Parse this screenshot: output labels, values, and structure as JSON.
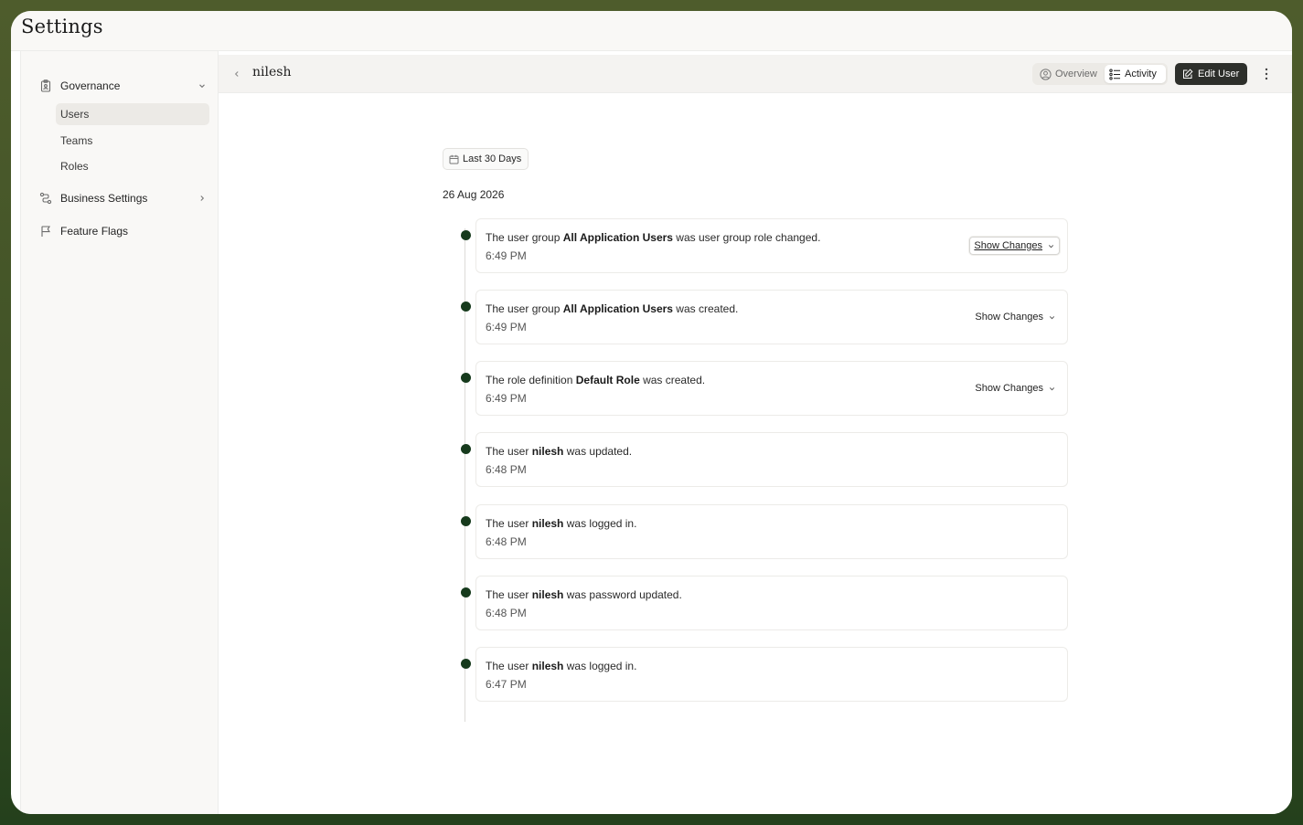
{
  "app": {
    "title": "Settings"
  },
  "sidebar": {
    "governance": {
      "label": "Governance",
      "icon": "clipboard-icon"
    },
    "sub_items": [
      {
        "label": "Users",
        "active": true
      },
      {
        "label": "Teams",
        "active": false
      },
      {
        "label": "Roles",
        "active": false
      }
    ],
    "business_settings": {
      "label": "Business Settings",
      "icon": "route-icon"
    },
    "feature_flags": {
      "label": "Feature Flags",
      "icon": "flag-icon"
    }
  },
  "header": {
    "user_name": "nilesh",
    "tabs": {
      "overview": "Overview",
      "activity": "Activity"
    },
    "edit_label": "Edit User"
  },
  "filter": {
    "range_label": "Last 30 Days"
  },
  "date_group": "26 Aug 2026",
  "activities": [
    {
      "prefix": "The user group ",
      "entity": "All Application Users",
      "suffix": " was user group role changed.",
      "time": "6:49 PM",
      "show_changes": "Show Changes"
    },
    {
      "prefix": "The user group ",
      "entity": "All Application Users",
      "suffix": " was created.",
      "time": "6:49 PM",
      "show_changes": "Show Changes"
    },
    {
      "prefix": "The role definition ",
      "entity": "Default Role",
      "suffix": " was created.",
      "time": "6:49 PM",
      "show_changes": "Show Changes"
    },
    {
      "prefix": "The user ",
      "entity": "nilesh",
      "suffix": " was updated.",
      "time": "6:48 PM"
    },
    {
      "prefix": "The user ",
      "entity": "nilesh",
      "suffix": " was logged in.",
      "time": "6:48 PM"
    },
    {
      "prefix": "The user ",
      "entity": "nilesh",
      "suffix": " was password updated.",
      "time": "6:48 PM"
    },
    {
      "prefix": "The user ",
      "entity": "nilesh",
      "suffix": " was logged in.",
      "time": "6:47 PM"
    }
  ],
  "colors": {
    "dot": "#163a1c",
    "primary_button": "#2d2f2b",
    "frame_border": "#3f5226"
  }
}
